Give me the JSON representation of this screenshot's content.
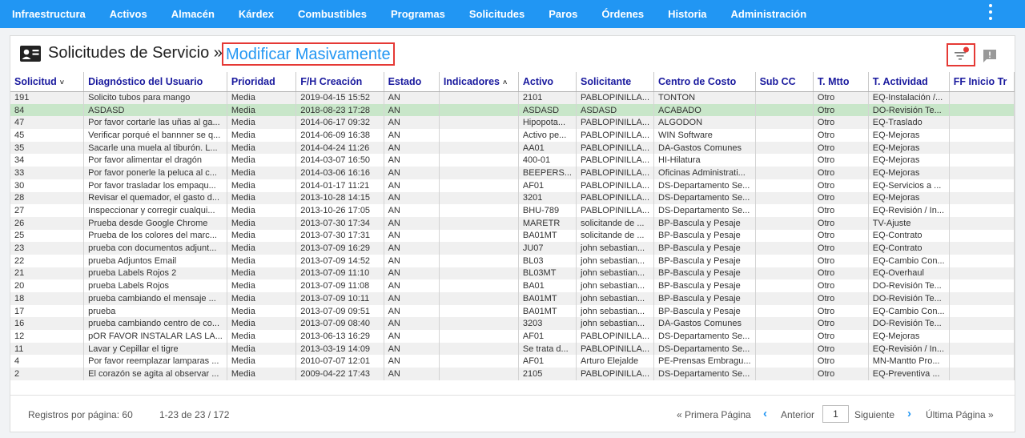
{
  "nav": {
    "items": [
      "Infraestructura",
      "Activos",
      "Almacén",
      "Kárdex",
      "Combustibles",
      "Programas",
      "Solicitudes",
      "Paros",
      "Órdenes",
      "Historia",
      "Administración"
    ]
  },
  "header": {
    "title": "Solicitudes de Servicio »",
    "link": "Modificar Masivamente",
    "icons": {
      "title": "id-card-icon",
      "filter": "filter-icon",
      "chat": "feedback-icon"
    },
    "colors": {
      "accent": "#2196f3",
      "highlight": "#e53935",
      "notification": "#e53935"
    }
  },
  "table": {
    "columns": [
      "Solicitud",
      "Diagnóstico del Usuario",
      "Prioridad",
      "F/H Creación",
      "Estado",
      "Indicadores",
      "Activo",
      "Solicitante",
      "Centro de Costo",
      "Sub CC",
      "T. Mtto",
      "T. Actividad",
      "FF Inicio Tr"
    ],
    "sort_indicators": [
      "˅",
      "˄"
    ],
    "selected_row": 1,
    "rows": [
      [
        "191",
        "Solicito tubos para mango",
        "Media",
        "2019-04-15 15:52",
        "AN",
        "",
        "2101",
        "PABLOPINILLA...",
        "TONTON",
        "",
        "Otro",
        "EQ-Instalación /...",
        ""
      ],
      [
        "84",
        "ASDASD",
        "Media",
        "2018-08-23 17:28",
        "AN",
        "",
        "ASDASD",
        "ASDASD",
        "ACABADO",
        "",
        "Otro",
        "DO-Revisión Te...",
        ""
      ],
      [
        "47",
        "Por favor cortarle las uñas al ga...",
        "Media",
        "2014-06-17 09:32",
        "AN",
        "",
        "Hipopota...",
        "PABLOPINILLA...",
        "ALGODON",
        "",
        "Otro",
        "EQ-Traslado",
        ""
      ],
      [
        "45",
        "Verificar porqué el bannner se q...",
        "Media",
        "2014-06-09 16:38",
        "AN",
        "",
        "Activo pe...",
        "PABLOPINILLA...",
        "WIN Software",
        "",
        "Otro",
        "EQ-Mejoras",
        ""
      ],
      [
        "35",
        "Sacarle una muela al tiburón. L...",
        "Media",
        "2014-04-24 11:26",
        "AN",
        "",
        "AA01",
        "PABLOPINILLA...",
        "DA-Gastos Comunes",
        "",
        "Otro",
        "EQ-Mejoras",
        ""
      ],
      [
        "34",
        "Por favor alimentar el dragón",
        "Media",
        "2014-03-07 16:50",
        "AN",
        "",
        "400-01",
        "PABLOPINILLA...",
        "HI-Hilatura",
        "",
        "Otro",
        "EQ-Mejoras",
        ""
      ],
      [
        "33",
        "Por favor ponerle la peluca al c...",
        "Media",
        "2014-03-06 16:16",
        "AN",
        "",
        "BEEPERS...",
        "PABLOPINILLA...",
        "Oficinas Administrati...",
        "",
        "Otro",
        "EQ-Mejoras",
        ""
      ],
      [
        "30",
        "Por favor trasladar los empaqu...",
        "Media",
        "2014-01-17 11:21",
        "AN",
        "",
        "AF01",
        "PABLOPINILLA...",
        "DS-Departamento Se...",
        "",
        "Otro",
        "EQ-Servicios a ...",
        ""
      ],
      [
        "28",
        "Revisar el quemador, el gasto d...",
        "Media",
        "2013-10-28 14:15",
        "AN",
        "",
        "3201",
        "PABLOPINILLA...",
        "DS-Departamento Se...",
        "",
        "Otro",
        "EQ-Mejoras",
        ""
      ],
      [
        "27",
        "Inspeccionar y corregir cualqui...",
        "Media",
        "2013-10-26 17:05",
        "AN",
        "",
        "BHU-789",
        "PABLOPINILLA...",
        "DS-Departamento Se...",
        "",
        "Otro",
        "EQ-Revisión / In...",
        ""
      ],
      [
        "26",
        "Prueba desde Google Chrome",
        "Media",
        "2013-07-30 17:34",
        "AN",
        "",
        "MARETR",
        "solicitande de ...",
        "BP-Bascula y Pesaje",
        "",
        "Otro",
        "TV-Ajuste",
        ""
      ],
      [
        "25",
        "Prueba de los colores del marc...",
        "Media",
        "2013-07-30 17:31",
        "AN",
        "",
        "BA01MT",
        "solicitande de ...",
        "BP-Bascula y Pesaje",
        "",
        "Otro",
        "EQ-Contrato",
        ""
      ],
      [
        "23",
        "prueba con documentos adjunt...",
        "Media",
        "2013-07-09 16:29",
        "AN",
        "",
        "JU07",
        "john sebastian...",
        "BP-Bascula y Pesaje",
        "",
        "Otro",
        "EQ-Contrato",
        ""
      ],
      [
        "22",
        "prueba Adjuntos Email",
        "Media",
        "2013-07-09 14:52",
        "AN",
        "",
        "BL03",
        "john sebastian...",
        "BP-Bascula y Pesaje",
        "",
        "Otro",
        "EQ-Cambio Con...",
        ""
      ],
      [
        "21",
        "prueba Labels Rojos 2",
        "Media",
        "2013-07-09 11:10",
        "AN",
        "",
        "BL03MT",
        "john sebastian...",
        "BP-Bascula y Pesaje",
        "",
        "Otro",
        "EQ-Overhaul",
        ""
      ],
      [
        "20",
        "prueba Labels Rojos",
        "Media",
        "2013-07-09 11:08",
        "AN",
        "",
        "BA01",
        "john sebastian...",
        "BP-Bascula y Pesaje",
        "",
        "Otro",
        "DO-Revisión Te...",
        ""
      ],
      [
        "18",
        "prueba cambiando el mensaje ...",
        "Media",
        "2013-07-09 10:11",
        "AN",
        "",
        "BA01MT",
        "john sebastian...",
        "BP-Bascula y Pesaje",
        "",
        "Otro",
        "DO-Revisión Te...",
        ""
      ],
      [
        "17",
        "prueba",
        "Media",
        "2013-07-09 09:51",
        "AN",
        "",
        "BA01MT",
        "john sebastian...",
        "BP-Bascula y Pesaje",
        "",
        "Otro",
        "EQ-Cambio Con...",
        ""
      ],
      [
        "16",
        "prueba cambiando centro de co...",
        "Media",
        "2013-07-09 08:40",
        "AN",
        "",
        "3203",
        "john sebastian...",
        "DA-Gastos Comunes",
        "",
        "Otro",
        "DO-Revisión Te...",
        ""
      ],
      [
        "12",
        "pOR FAVOR INSTALAR LAS LA...",
        "Media",
        "2013-06-13 16:29",
        "AN",
        "",
        "AF01",
        "PABLOPINILLA...",
        "DS-Departamento Se...",
        "",
        "Otro",
        "EQ-Mejoras",
        ""
      ],
      [
        "11",
        "Lavar y Cepillar el tigre",
        "Media",
        "2013-03-19 14:09",
        "AN",
        "",
        "Se trata d...",
        "PABLOPINILLA...",
        "DS-Departamento Se...",
        "",
        "Otro",
        "EQ-Revisión / In...",
        ""
      ],
      [
        "4",
        "Por favor reemplazar lamparas ...",
        "Media",
        "2010-07-07 12:01",
        "AN",
        "",
        "AF01",
        "Arturo Elejalde",
        "PE-Prensas Embragu...",
        "",
        "Otro",
        "MN-Mantto Pro...",
        ""
      ],
      [
        "2",
        "El corazón se agita al observar ...",
        "Media",
        "2009-04-22 17:43",
        "AN",
        "",
        "2105",
        "PABLOPINILLA...",
        "DS-Departamento Se...",
        "",
        "Otro",
        "EQ-Preventiva ...",
        ""
      ]
    ]
  },
  "footer": {
    "records_per_page": "Registros por página: 60",
    "range": "1-23 de 23 / 172",
    "first_page": "« Primera Página",
    "prev": "Anterior",
    "page_value": "1",
    "next": "Siguiente",
    "last_page": "Última Página »"
  }
}
